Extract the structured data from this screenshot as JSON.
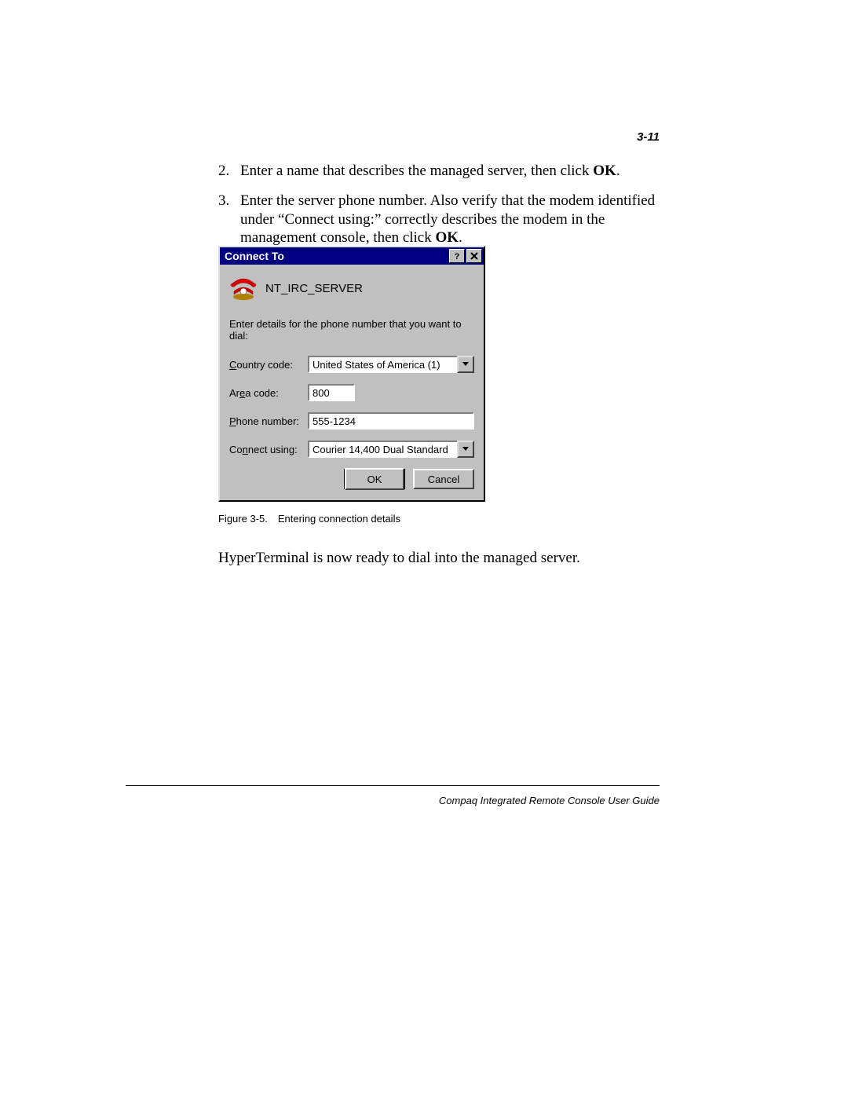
{
  "page_number": "3-11",
  "steps": {
    "s2_num": "2.",
    "s2_text_a": "Enter a name that describes the managed server, then click ",
    "s2_text_b": "OK",
    "s2_text_c": ".",
    "s3_num": "3.",
    "s3_text_a": "Enter the server phone number. Also verify that the modem identified under “Connect using:” correctly describes the modem in the management console, then click ",
    "s3_text_b": "OK",
    "s3_text_c": "."
  },
  "dialog": {
    "title": "Connect To",
    "connection_name": "NT_IRC_SERVER",
    "instruction": "Enter details for the phone number that you want to dial:",
    "fields": {
      "country_label_pre": "C",
      "country_label_post": "ountry code:",
      "country_value": "United States of America (1)",
      "area_label_pre": "Ar",
      "area_label_mid": "e",
      "area_label_post": "a code:",
      "area_value": "800",
      "phone_label_pre": "P",
      "phone_label_post": "hone number:",
      "phone_value": "555-1234",
      "connect_label_pre": "Co",
      "connect_label_mid": "n",
      "connect_label_post": "nect using:",
      "connect_value": "Courier 14,400 Dual Standard"
    },
    "buttons": {
      "ok": "OK",
      "cancel": "Cancel"
    }
  },
  "caption": "Figure 3-5. Entering connection details",
  "post_text": "HyperTerminal is now ready to dial into the managed server.",
  "footer": "Compaq Integrated Remote Console User Guide"
}
